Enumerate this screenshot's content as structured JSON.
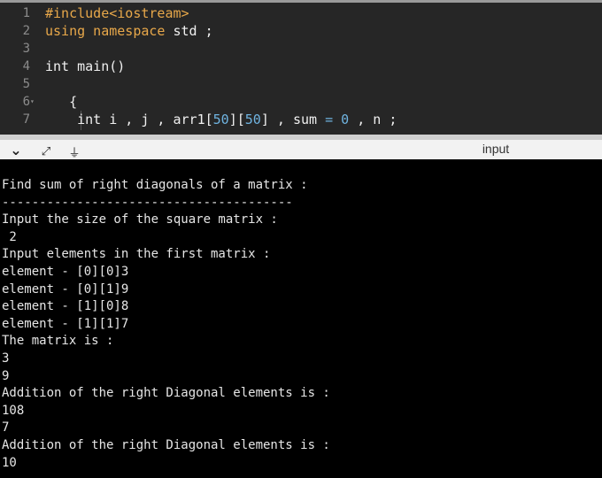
{
  "editor": {
    "lines": [
      {
        "no": "1",
        "text": "#include<iostream>"
      },
      {
        "no": "2",
        "kw": "using namespace",
        "rest": " std ;"
      },
      {
        "no": "3",
        "text": ""
      },
      {
        "no": "4",
        "text": "int main()"
      },
      {
        "no": "5",
        "text": ""
      },
      {
        "no": "6",
        "text": "   {"
      },
      {
        "no": "7",
        "text": ""
      }
    ],
    "fold_marker": "▾",
    "line7": {
      "a": "    int i , j , arr1[",
      "n1": "50",
      "b": "][",
      "n2": "50",
      "c": "] , sum ",
      "eq": "=",
      "sp": " ",
      "zero": "0",
      "d": " , n ;"
    }
  },
  "toolbar": {
    "chevron_icon": "⌄",
    "expand_icon": "⤢",
    "run_icon": "⏚",
    "input_label": "input"
  },
  "console": {
    "lines": [
      "Find sum of right diagonals of a matrix :",
      "---------------------------------------",
      "Input the size of the square matrix :",
      " 2",
      "Input elements in the first matrix :",
      "element - [0][0]3",
      "element - [0][1]9",
      "element - [1][0]8",
      "element - [1][1]7",
      "The matrix is :",
      "3",
      "9",
      "Addition of the right Diagonal elements is :",
      "108",
      "7",
      "Addition of the right Diagonal elements is :",
      "10"
    ]
  }
}
